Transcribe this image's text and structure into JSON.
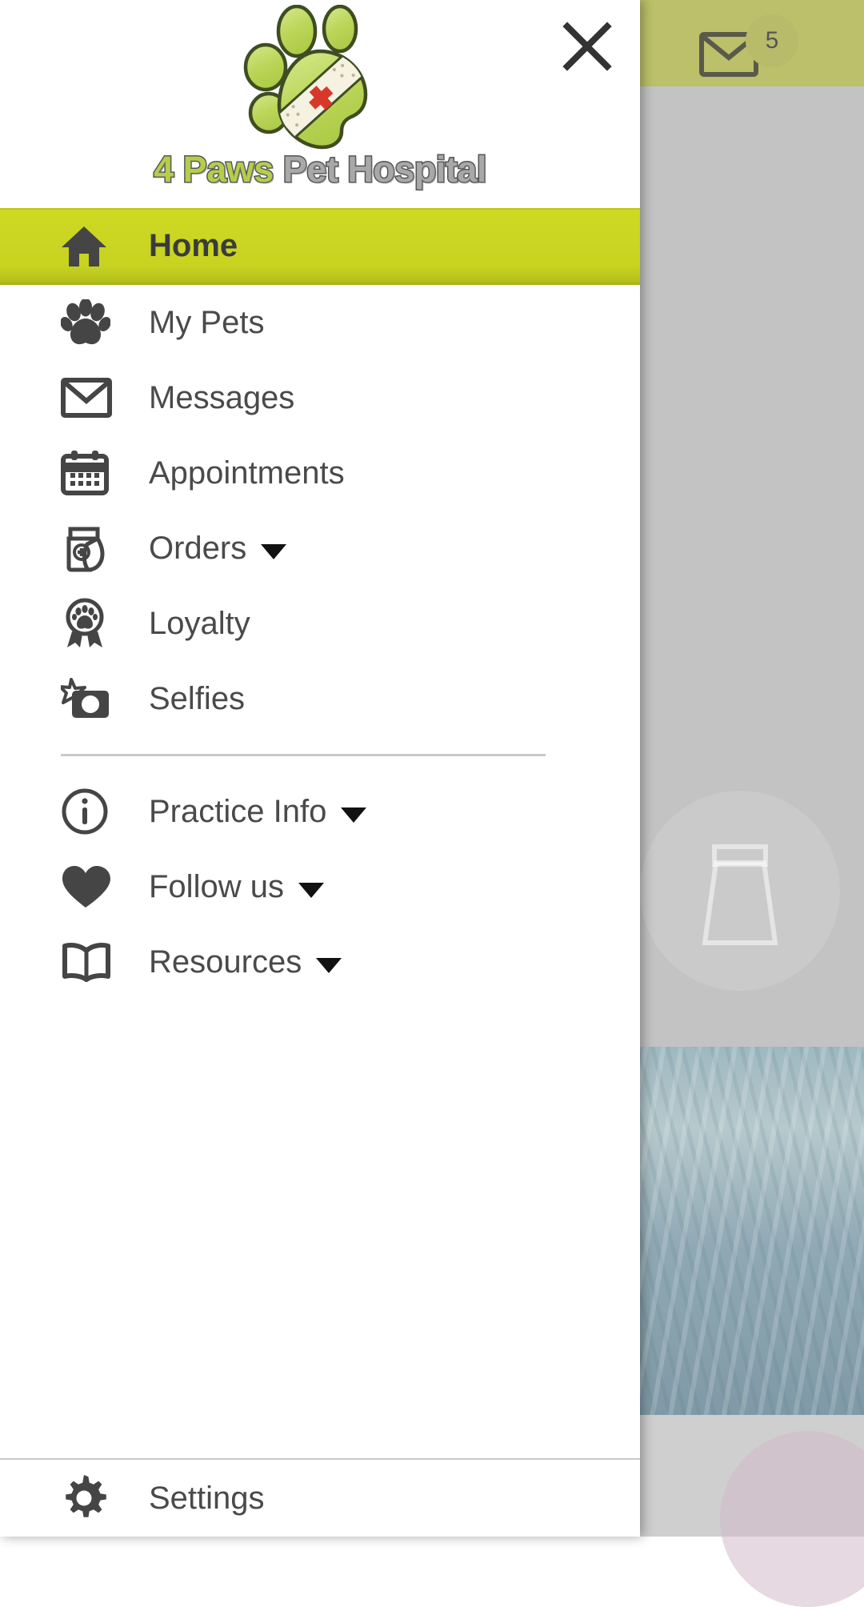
{
  "background": {
    "mail_icon": "mail-icon",
    "badge_count": "5",
    "watermark_icon": "bag-watermark-icon"
  },
  "drawer": {
    "close_label": "×",
    "close_icon": "close-icon",
    "logo_icon": "paw-logo-icon",
    "brand": {
      "part_green": "4 Paws",
      "part_gray": "Pet Hospital",
      "color_green": "#b4ce4a",
      "color_gray": "#a8a8a8"
    },
    "accent_color": "#c8d420",
    "text_color": "#4a4a4a",
    "primary_items": [
      {
        "label": "Home",
        "icon": "home-icon",
        "active": true,
        "has_caret": false
      },
      {
        "label": "My Pets",
        "icon": "paw-icon",
        "active": false,
        "has_caret": false
      },
      {
        "label": "Messages",
        "icon": "envelope-icon",
        "active": false,
        "has_caret": false
      },
      {
        "label": "Appointments",
        "icon": "calendar-icon",
        "active": false,
        "has_caret": false
      },
      {
        "label": "Orders",
        "icon": "food-bag-icon",
        "active": false,
        "has_caret": true
      },
      {
        "label": "Loyalty",
        "icon": "medal-paw-icon",
        "active": false,
        "has_caret": false
      },
      {
        "label": "Selfies",
        "icon": "camera-star-icon",
        "active": false,
        "has_caret": false
      }
    ],
    "secondary_items": [
      {
        "label": "Practice Info",
        "icon": "info-circle-icon",
        "has_caret": true
      },
      {
        "label": "Follow us",
        "icon": "heart-icon",
        "has_caret": true
      },
      {
        "label": "Resources",
        "icon": "book-icon",
        "has_caret": true
      }
    ],
    "bottom_items": [
      {
        "label": "Settings",
        "icon": "gear-icon",
        "has_caret": false
      }
    ]
  }
}
